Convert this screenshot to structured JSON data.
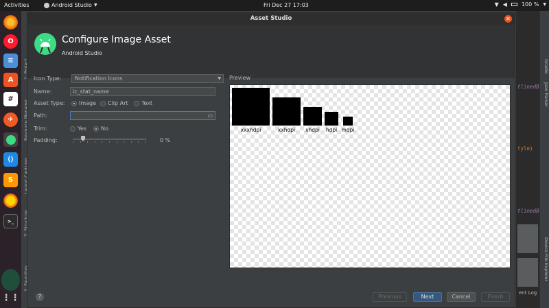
{
  "topbar": {
    "activities": "Activities",
    "app_name": "Android Studio",
    "clock": "Fri Dec 27  17:03",
    "battery": "100 %"
  },
  "dock": [
    "firefox-icon",
    "opera-icon",
    "text-editor-icon",
    "software-center-icon",
    "slack-icon",
    "postman-icon",
    "android-studio-icon",
    "vscode-icon",
    "sublime-text-icon",
    "yellow-ball-icon",
    "terminal-icon",
    "apps-grid-icon"
  ],
  "ide": {
    "left_tabs": [
      "1: Project",
      "Resource Manager",
      "Layout Captures",
      "7: Structure",
      "2: Favorites"
    ],
    "right_tabs": [
      "Gradle",
      "Json Parser",
      "Device File Explorer"
    ],
    "code_fragments": [
      "tlinedB",
      "tyle)",
      "tlinedB"
    ],
    "event_log": "ent Log"
  },
  "dialog": {
    "window_title": "Asset Studio",
    "header_title": "Configure Image Asset",
    "header_subtitle": "Android Studio",
    "icon_type_label": "Icon Type:",
    "icon_type_value": "Notification Icons",
    "name_label": "Name:",
    "name_value": "ic_stat_name",
    "asset_type_label": "Asset Type:",
    "asset_type_options": [
      "Image",
      "Clip Art",
      "Text"
    ],
    "asset_type_selected": "Image",
    "path_label": "Path:",
    "path_value": "",
    "trim_label": "Trim:",
    "trim_options": [
      "Yes",
      "No"
    ],
    "trim_selected": "No",
    "padding_label": "Padding:",
    "padding_value": "0 %",
    "padding_percent": 0,
    "preview_label": "Preview",
    "densities": [
      "xxxhdpi",
      "xxhdpi",
      "xhdpi",
      "hdpi",
      "mdpi"
    ],
    "buttons": {
      "help": "?",
      "previous": "Previous",
      "next": "Next",
      "cancel": "Cancel",
      "finish": "Finish"
    }
  },
  "colors": {
    "accent": "#365880",
    "ubuntu_orange": "#e95420",
    "android_green": "#3ddc84"
  }
}
